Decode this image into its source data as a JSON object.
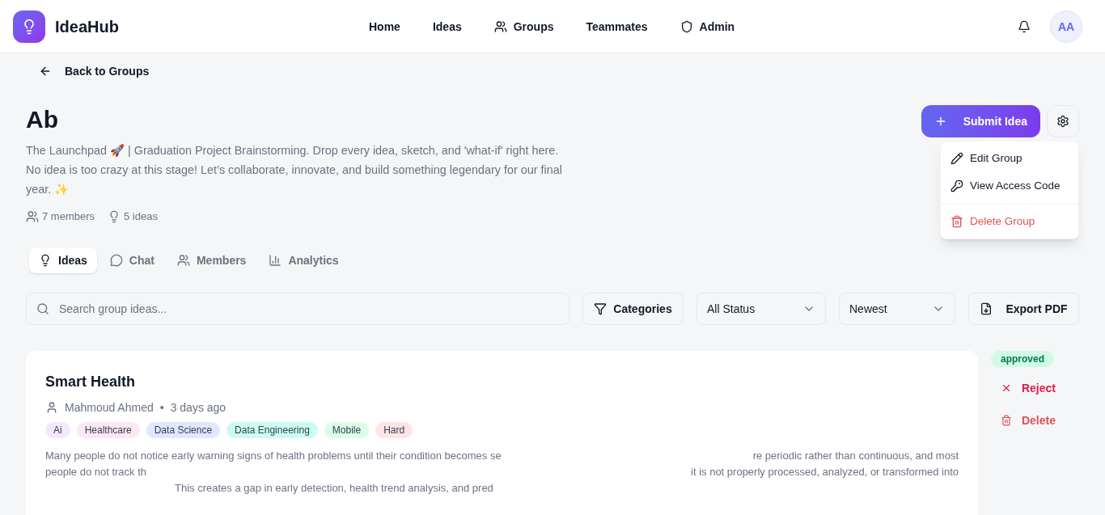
{
  "brand": {
    "name": "IdeaHub"
  },
  "nav": [
    {
      "label": "Home"
    },
    {
      "label": "Ideas"
    },
    {
      "label": "Groups"
    },
    {
      "label": "Teammates"
    },
    {
      "label": "Admin"
    }
  ],
  "user": {
    "initials": "AA"
  },
  "back_link": "Back to Groups",
  "group": {
    "name": "Ab",
    "description": "The Launchpad 🚀 | Graduation Project Brainstorming. Drop every idea, sketch, and 'what-if' right here. No idea is too crazy at this stage! Let’s collaborate, innovate, and build something legendary for our final year. ✨",
    "members": "7 members",
    "ideas": "5 ideas"
  },
  "submit_button": "Submit Idea",
  "settings_menu": [
    {
      "label": "Edit Group",
      "kind": "edit"
    },
    {
      "label": "View Access Code",
      "kind": "key"
    },
    {
      "label": "Delete Group",
      "kind": "danger"
    }
  ],
  "tabs": [
    {
      "label": "Ideas",
      "selected": true
    },
    {
      "label": "Chat",
      "selected": false
    },
    {
      "label": "Members",
      "selected": false
    },
    {
      "label": "Analytics",
      "selected": false
    }
  ],
  "search": {
    "placeholder": "Search group ideas..."
  },
  "filters": {
    "categories": "Categories",
    "status": "All Status",
    "sort": "Newest",
    "export": "Export PDF"
  },
  "ideas": [
    {
      "title": "Smart Health",
      "author": "Mahmoud Ahmed",
      "separator": "•",
      "time": "3 days ago",
      "tags": [
        {
          "label": "Ai",
          "color": "#f3e8ff"
        },
        {
          "label": "Healthcare",
          "color": "#fce7f3"
        },
        {
          "label": "Data Science",
          "color": "#e0e7ff"
        },
        {
          "label": "Data Engineering",
          "color": "#ccfbf1"
        },
        {
          "label": "Mobile",
          "color": "#dcfce7"
        },
        {
          "label": "Hard",
          "color": "#ffe4e6"
        }
      ],
      "description_lines": [
        [
          "Many people do not notice early warning signs of health problems until their condition becomes se",
          "re periodic rather than continuous, and most"
        ],
        [
          "people do not track th",
          "it is not properly processed, analyzed, or transformed into"
        ],
        [
          "This creates a gap in early detection, health trend analysis, and pred"
        ]
      ],
      "status": "approved",
      "actions": [
        {
          "label": "Reject",
          "kind": "reject"
        },
        {
          "label": "Delete",
          "kind": "delete"
        }
      ]
    }
  ]
}
